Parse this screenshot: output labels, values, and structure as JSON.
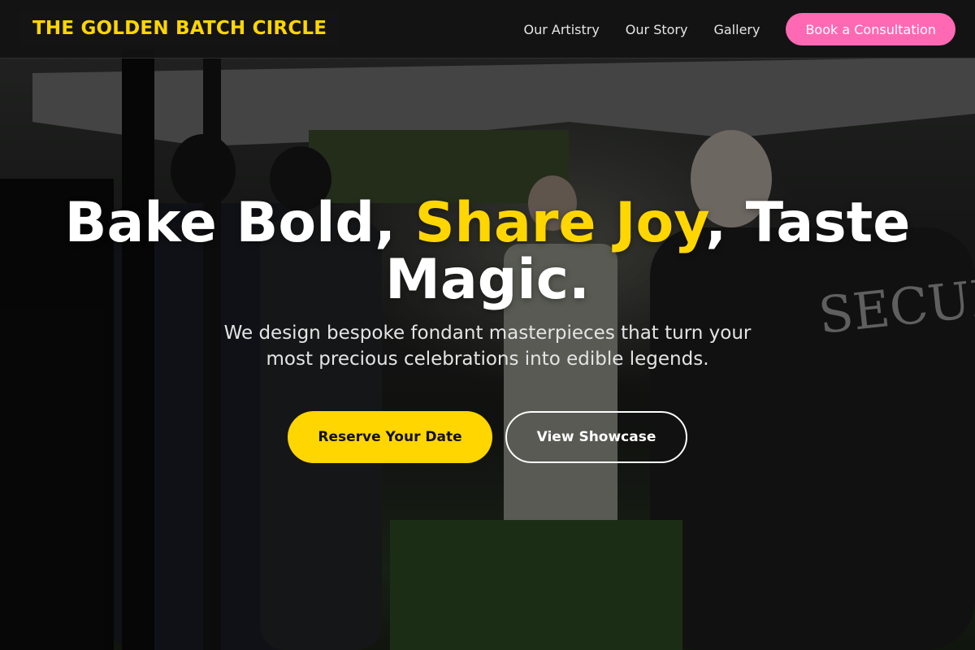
{
  "header": {
    "brand": "THE GOLDEN BATCH CIRCLE",
    "nav": [
      "Our Artistry",
      "Our Story",
      "Gallery"
    ],
    "cta": "Book a Consultation"
  },
  "hero": {
    "title_part1": "Bake Bold, ",
    "title_accent": "Share Joy",
    "title_part2": ", Taste Magic.",
    "subtitle": "We design bespoke fondant masterpieces that turn your most precious celebrations into edible legends.",
    "primary_button": "Reserve Your Date",
    "secondary_button": "View Showcase",
    "background_text": "SECURIT"
  },
  "colors": {
    "accent": "#ffd600",
    "cta_pink": "#ff69b4"
  }
}
